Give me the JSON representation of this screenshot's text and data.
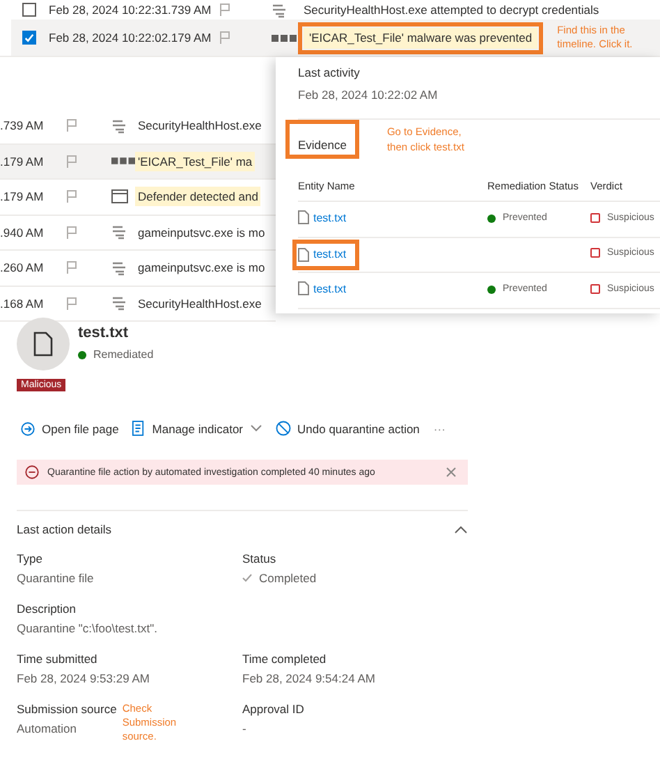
{
  "timeline": [
    {
      "checked": false,
      "time": "Feb 28, 2024 10:22:31.739 AM",
      "kind": "process",
      "title": "SecurityHealthHost.exe attempted to decrypt credentials",
      "selected": false,
      "annotated": false
    },
    {
      "checked": true,
      "time": "Feb 28, 2024 10:22:02.179 AM",
      "kind": "alert",
      "title": "'EICAR_Test_File' malware was prevented",
      "selected": true,
      "annotated": true,
      "note": "Find this in the timeline. Click it."
    }
  ],
  "timeline_behind": [
    {
      "time": ".739 AM",
      "kind": "process",
      "title": "SecurityHealthHost.exe",
      "selected": false
    },
    {
      "time": ".179 AM",
      "kind": "alert",
      "title": "'EICAR_Test_File' ma",
      "selected": true
    },
    {
      "time": ".179 AM",
      "kind": "defender",
      "title": "Defender detected and",
      "selected": false
    },
    {
      "time": ".940 AM",
      "kind": "process",
      "title": "gameinputsvc.exe is mo",
      "selected": false
    },
    {
      "time": ".260 AM",
      "kind": "process",
      "title": "gameinputsvc.exe is mo",
      "selected": false
    },
    {
      "time": ".168 AM",
      "kind": "process",
      "title": "SecurityHealthHost.exe",
      "selected": false
    }
  ],
  "alert_panel": {
    "last_activity_label": "Last activity",
    "last_activity": "Feb 28, 2024 10:22:02 AM",
    "evidence_label": "Evidence",
    "evidence_annotated": true,
    "note_lines": [
      "Go to Evidence,",
      "then click test.txt"
    ],
    "columns": [
      "Entity Name",
      "Remediation Status",
      "Verdict"
    ],
    "rows": [
      {
        "name": "test.txt",
        "status": "Prevented",
        "verdict": "Suspicious",
        "annotated": false
      },
      {
        "name": "test.txt",
        "verdict": "Suspicious",
        "annotated": true
      },
      {
        "name": "test.txt",
        "status": "Prevented",
        "verdict": "Suspicious",
        "annotated": false
      }
    ]
  },
  "file_details": {
    "name": "test.txt",
    "status": "Remediated",
    "tag": "Malicious",
    "actions": [
      {
        "kind": "open",
        "label": "Open file page",
        "dropdown": false
      },
      {
        "kind": "indicator",
        "label": "Manage indicator",
        "dropdown": true
      },
      {
        "kind": "undo",
        "label": "Undo quarantine action",
        "dropdown": false
      }
    ],
    "more": "···",
    "banner": {
      "text": "Quarantine file action by automated investigation completed 40 minutes ago",
      "dismissible": true
    },
    "section": {
      "title": "Last action details",
      "expanded": true,
      "fields": [
        {
          "label": "Type",
          "value": "Quarantine file"
        },
        {
          "label": "Status",
          "value": "Completed",
          "kind": "status"
        },
        {
          "label": "Description",
          "value": "Quarantine \"c:\\foo\\test.txt\".",
          "kind": "wide"
        },
        {
          "label": "Time submitted",
          "value": "Feb 28, 2024 9:53:29 AM"
        },
        {
          "label": "Time completed",
          "value": "Feb 28, 2024 9:54:24 AM"
        },
        {
          "label": "Submission source",
          "value": "Automation",
          "note": "Check Submission source."
        },
        {
          "label": "Approval ID",
          "value": "-"
        }
      ]
    }
  }
}
